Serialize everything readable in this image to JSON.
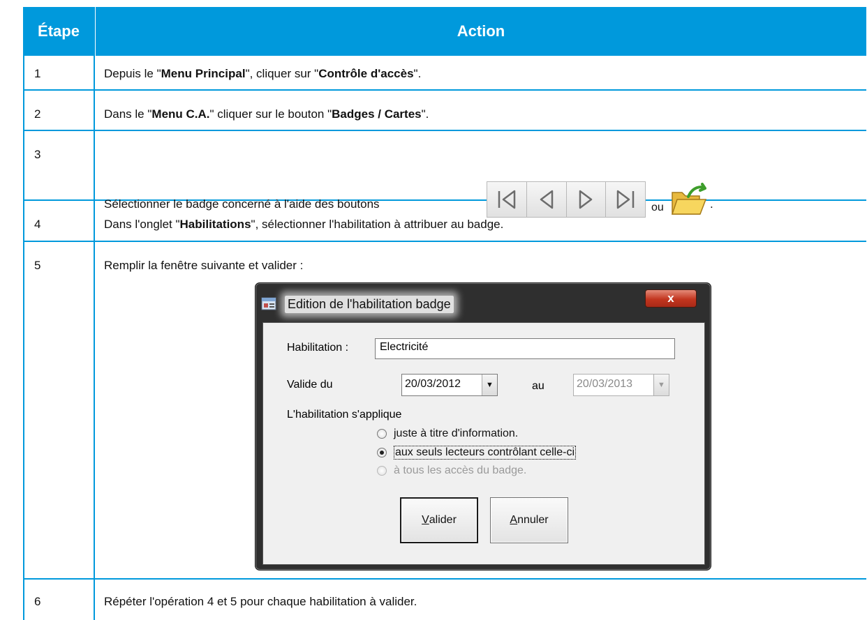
{
  "table": {
    "headers": {
      "step": "Étape",
      "action": "Action"
    },
    "rows": [
      {
        "step": "1",
        "parts": [
          "Depuis le \"",
          "Menu Principal",
          "\", cliquer sur \"",
          "Contrôle d'accès",
          "\"."
        ]
      },
      {
        "step": "2",
        "parts": [
          "Dans le \"",
          "Menu C.A.",
          "\" cliquer sur le bouton \"",
          "Badges / Cartes",
          "\"."
        ]
      },
      {
        "step": "3",
        "text_before": "Sélectionner le badge concerné à l'aide des boutons",
        "text_or": "ou",
        "text_end": "."
      },
      {
        "step": "4",
        "parts": [
          "Dans l'onglet \"",
          "Habilitations",
          "\", sélectionner l'habilitation à attribuer au badge."
        ]
      },
      {
        "step": "5",
        "text": "Remplir la fenêtre suivante et valider :"
      },
      {
        "step": "6",
        "text": "Répéter l'opération 4 et 5 pour chaque habilitation à valider."
      }
    ]
  },
  "nav_icons": [
    "first-record-icon",
    "previous-record-icon",
    "next-record-icon",
    "last-record-icon"
  ],
  "folder_icon": "open-folder-icon",
  "dialog": {
    "title": "Edition de l'habilitation badge",
    "close_label": "x",
    "habilitation_label": "Habilitation :",
    "habilitation_value": "Electricité",
    "valide_du_label": "Valide du",
    "date_from": "20/03/2012",
    "au_label": "au",
    "date_to": "20/03/2013",
    "applies_label": "L'habilitation s'applique",
    "options": [
      {
        "label": "juste à titre d'information.",
        "checked": false,
        "disabled": false
      },
      {
        "label": "aux seuls lecteurs contrôlant celle-ci",
        "checked": true,
        "disabled": false
      },
      {
        "label": "à tous les accès du badge.",
        "checked": false,
        "disabled": true
      }
    ],
    "validate_mnemonic": "V",
    "validate_rest": "alider",
    "cancel_mnemonic": "A",
    "cancel_rest": "nnuler"
  },
  "colors": {
    "accent": "#0099dc",
    "header_text": "#ffffff"
  }
}
